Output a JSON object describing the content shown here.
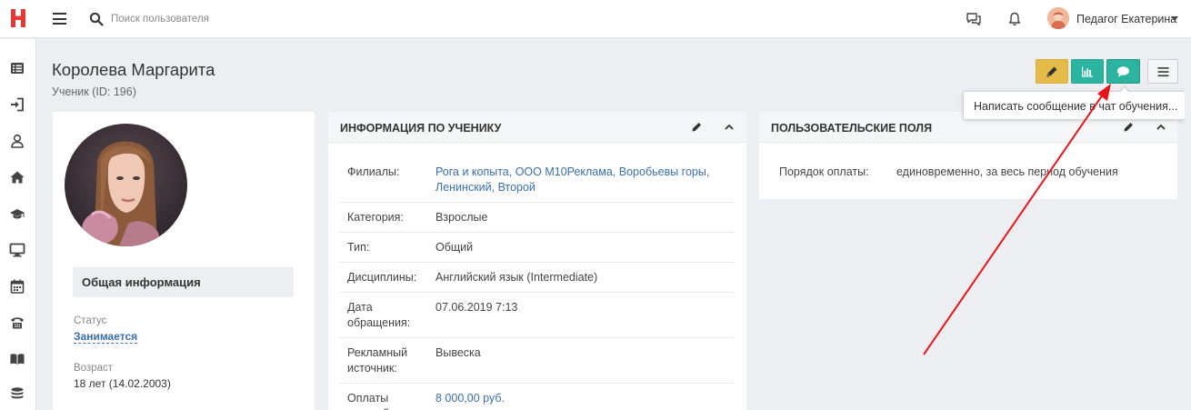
{
  "app": {
    "logo": "Н",
    "logo_color": "#e53935",
    "search": {
      "placeholder": "Поиск пользователя"
    },
    "user": {
      "name": "Педагог Екатерина"
    }
  },
  "sidebar": {
    "items": [
      {
        "icon": "list-icon"
      },
      {
        "icon": "sign-in-icon"
      },
      {
        "icon": "user-icon"
      },
      {
        "icon": "home-icon"
      },
      {
        "icon": "graduation-cap-icon"
      },
      {
        "icon": "monitor-icon"
      },
      {
        "icon": "calendar-icon"
      },
      {
        "icon": "phone-icon"
      },
      {
        "icon": "book-icon"
      },
      {
        "icon": "coins-icon"
      }
    ]
  },
  "header": {
    "title": "Королева Маргарита",
    "subtitle": "Ученик (ID: 196)"
  },
  "actions": {
    "tooltip": "Написать сообщение в чат обучения..."
  },
  "profile": {
    "section_title": "Общая информация",
    "status_label": "Статус",
    "status_value": "Занимается",
    "age_label": "Возраст",
    "age_value": "18 лет (14.02.2003)"
  },
  "student_info": {
    "title": "ИНФОРМАЦИЯ ПО УЧЕНИКУ",
    "rows": [
      {
        "label": "Филиалы:",
        "value": "Рога и копыта, ООО М10Реклама, Воробьевы горы, Ленинский, Второй",
        "link": true
      },
      {
        "label": "Категория:",
        "value": "Взрослые",
        "link": false
      },
      {
        "label": "Тип:",
        "value": "Общий",
        "link": false
      },
      {
        "label": "Дисциплины:",
        "value": "Английский язык (Intermediate)",
        "link": false
      },
      {
        "label": "Дата обращения:",
        "value": "07.06.2019 7:13",
        "link": false
      },
      {
        "label": "Рекламный источник:",
        "value": "Вывеска",
        "link": false
      },
      {
        "label": "Оплаты занятий:",
        "value": "8 000,00 руб.",
        "link": true
      }
    ]
  },
  "custom_fields": {
    "title": "ПОЛЬЗОВАТЕЛЬСКИЕ ПОЛЯ",
    "rows": [
      {
        "label": "Порядок оплаты:",
        "value": "единовременно, за весь период обучения"
      }
    ]
  },
  "colors": {
    "accent_teal": "#2db4a0",
    "accent_yellow": "#e4bb49",
    "link_blue": "#3a6fab",
    "annotation_red": "#e8141b"
  }
}
